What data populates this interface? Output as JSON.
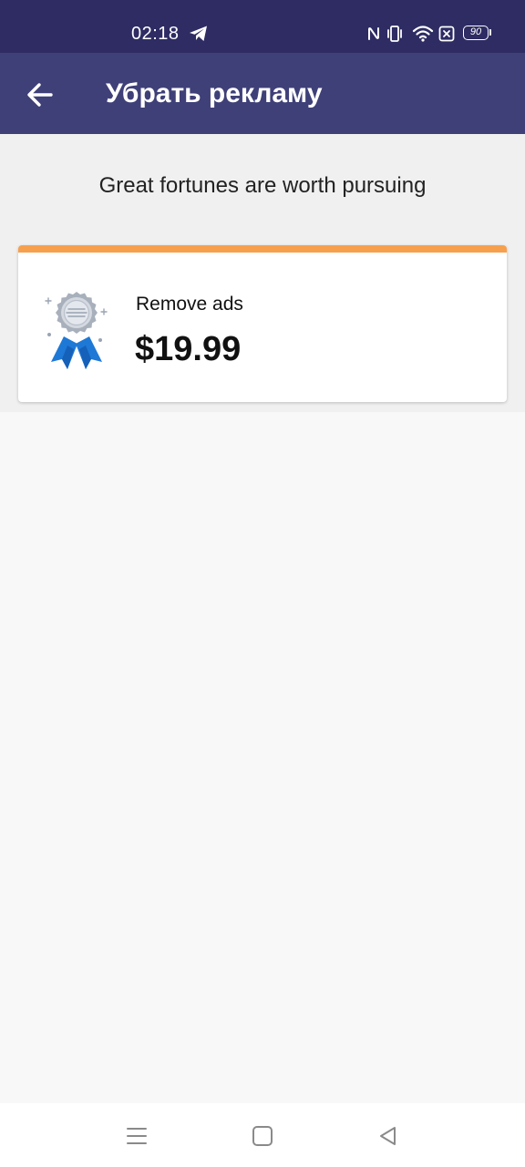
{
  "status_bar": {
    "time": "02:18",
    "battery_level": "90",
    "icons": [
      "telegram-icon",
      "nfc-icon",
      "vibrate-icon",
      "wifi-icon",
      "sim-x-icon",
      "battery-icon"
    ]
  },
  "app_bar": {
    "title": "Убрать рекламу",
    "back_icon": "arrow-left-icon",
    "color": "#3f4078"
  },
  "main": {
    "tagline": "Great fortunes are worth pursuing",
    "products": [
      {
        "name": "Remove ads",
        "price": "$19.99",
        "icon": "award-ribbon-icon",
        "accent_color": "#f6a04d"
      }
    ]
  },
  "nav_bar": {
    "buttons": [
      "menu-icon",
      "home-square-icon",
      "back-triangle-icon"
    ]
  },
  "colors": {
    "status_bar": "#2e2c63",
    "app_bar": "#3f4078",
    "accent": "#f6a04d",
    "badge_blue": "#1e78d6"
  }
}
